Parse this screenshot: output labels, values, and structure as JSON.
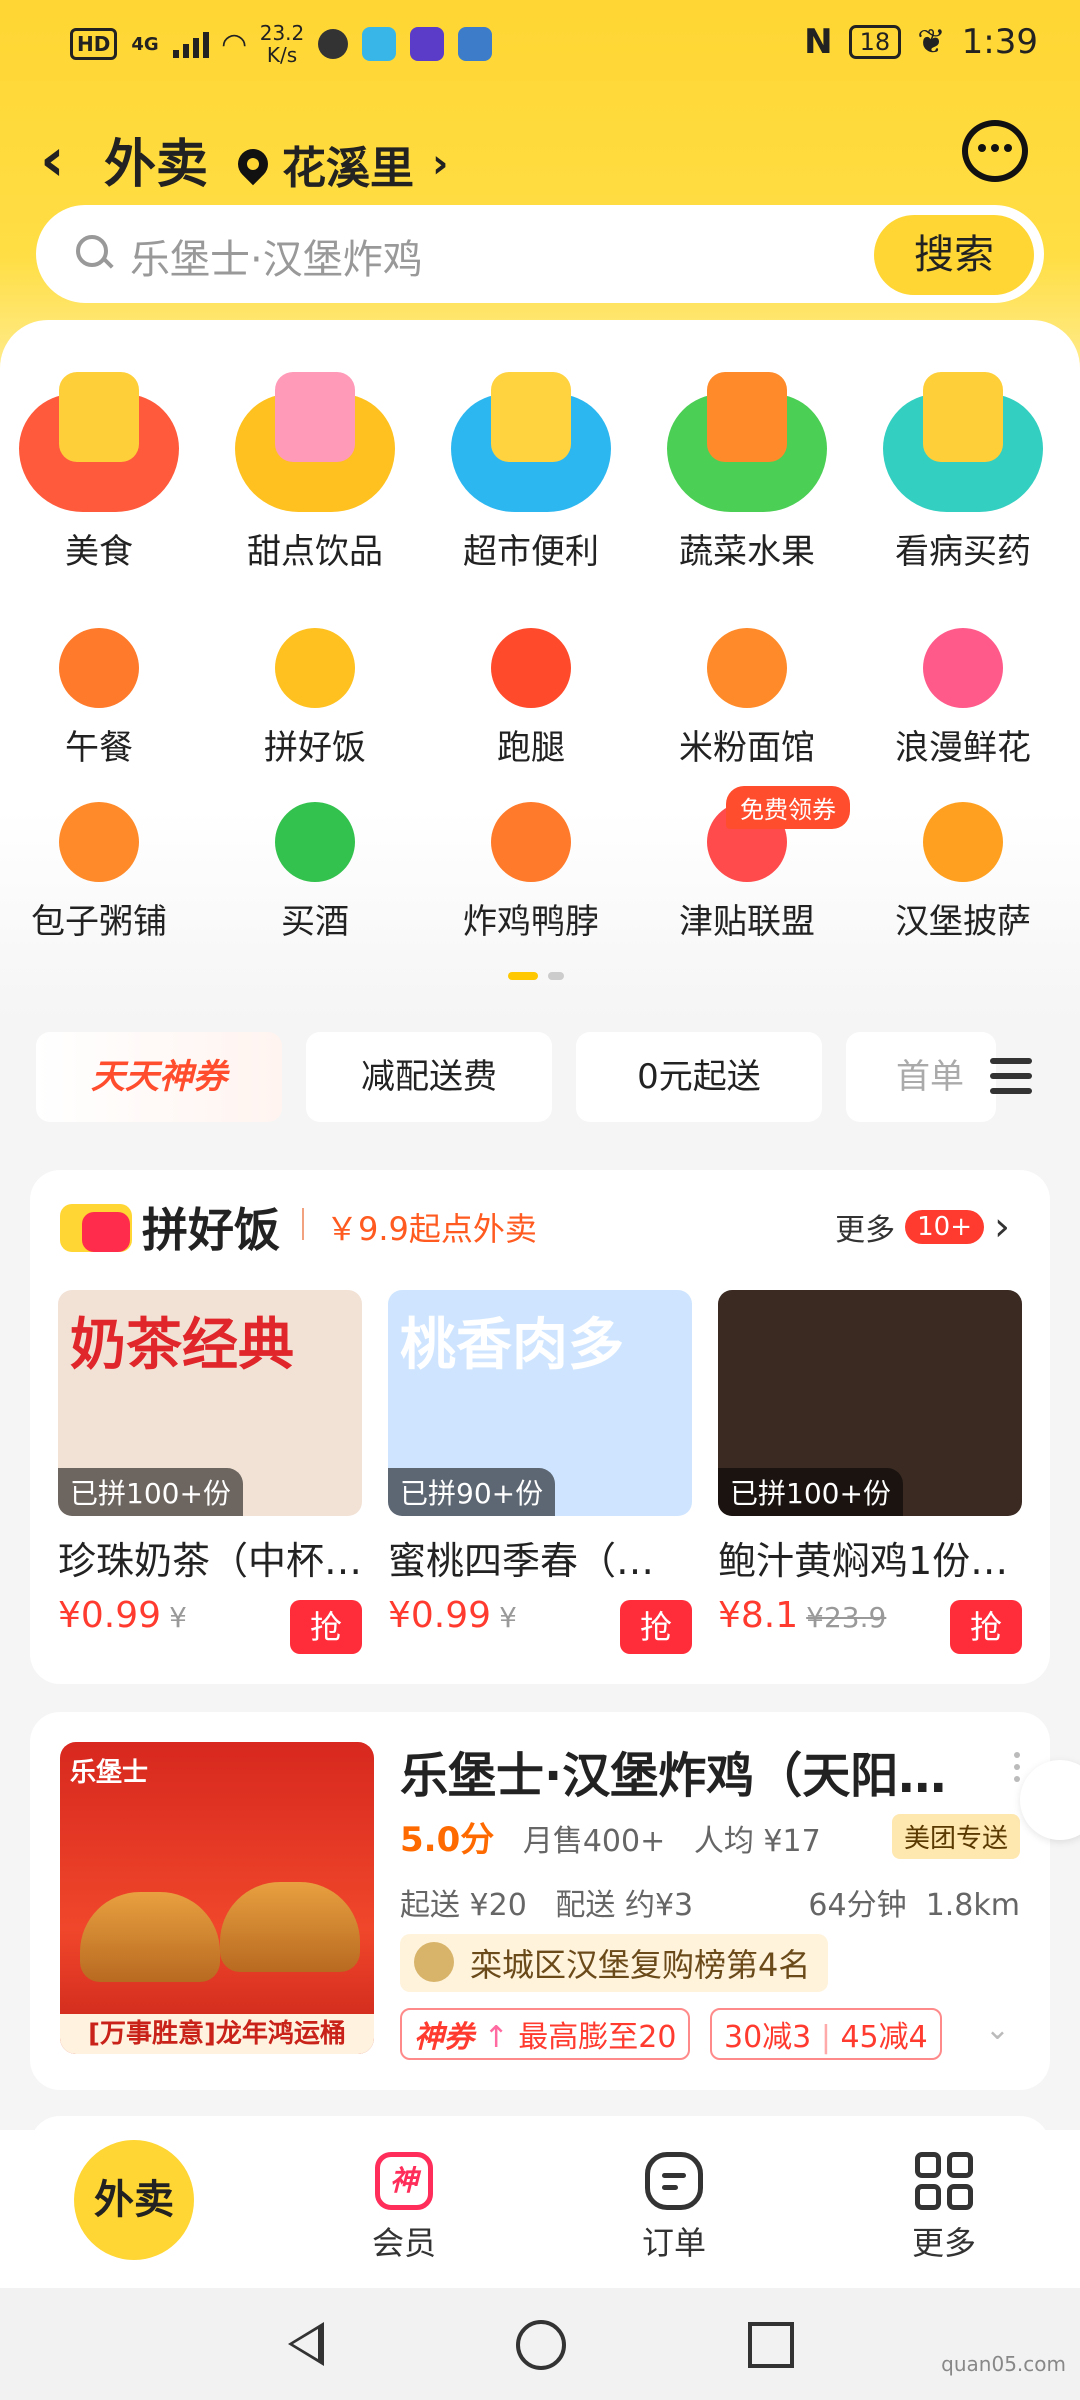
{
  "status_bar": {
    "hd": "HD",
    "net": "4G",
    "speed_val": "23.2",
    "speed_unit": "K/s",
    "battery": "18",
    "time": "1:39"
  },
  "header": {
    "title": "外卖",
    "location": "花溪里"
  },
  "search": {
    "placeholder": "乐堡士·汉堡炸鸡",
    "button": "搜索"
  },
  "categories_big": [
    {
      "label": "美食",
      "color": "#ff5a3c",
      "obj": "#ffcf3a"
    },
    {
      "label": "甜点饮品",
      "color": "#ffc11f",
      "obj": "#ff9ab8"
    },
    {
      "label": "超市便利",
      "color": "#2db7f0",
      "obj": "#ffd23f"
    },
    {
      "label": "蔬菜水果",
      "color": "#4ccf55",
      "obj": "#ff8a2a"
    },
    {
      "label": "看病买药",
      "color": "#33cfc0",
      "obj": "#ffcf3a"
    }
  ],
  "categories_small_row1": [
    {
      "label": "午餐",
      "color": "#ff7a2a"
    },
    {
      "label": "拼好饭",
      "color": "#ffc11f"
    },
    {
      "label": "跑腿",
      "color": "#ff4b2b"
    },
    {
      "label": "米粉面馆",
      "color": "#ff8a2a"
    },
    {
      "label": "浪漫鲜花",
      "color": "#ff5a8a"
    }
  ],
  "categories_small_row2": [
    {
      "label": "包子粥铺",
      "color": "#ff8a2a"
    },
    {
      "label": "买酒",
      "color": "#33c24d"
    },
    {
      "label": "炸鸡鸭脖",
      "color": "#ff7a2a"
    },
    {
      "label": "津贴联盟",
      "color": "#ff4b4b"
    },
    {
      "label": "汉堡披萨",
      "color": "#ffa020"
    }
  ],
  "subsidy_badge": "免费领券",
  "filters": {
    "f1": "天天神券",
    "f2": "减配送费",
    "f3": "0元起送",
    "f4": "首单"
  },
  "group_deal": {
    "title": "拼好饭",
    "subtitle": "￥9.9起点外卖",
    "more": "更多",
    "more_count": "10+",
    "items": [
      {
        "headline": "奶茶经典",
        "joined": "已拼100+份",
        "name": "珍珠奶茶（中杯…",
        "price": "¥0.99",
        "orig": "¥",
        "buy": "抢",
        "bg": "#f2e2d6",
        "hc": "#e0262a"
      },
      {
        "headline": "桃香肉多",
        "joined": "已拼90+份",
        "name": "蜜桃四季春（…",
        "price": "¥0.99",
        "orig": "¥",
        "buy": "抢",
        "bg": "#cfe5ff",
        "hc": "#ffffff"
      },
      {
        "headline": "",
        "joined": "已拼100+份",
        "name": "鲍汁黄焖鸡1份…",
        "price": "¥8.1",
        "orig": "¥23.9",
        "buy": "抢",
        "bg": "#3a2a22",
        "hc": "#ffffff"
      }
    ]
  },
  "store": {
    "brand": "乐堡士",
    "banner": "[万事胜意]龙年鸿运桶",
    "name": "乐堡士·汉堡炸鸡（天阳…",
    "rating": "5.0分",
    "monthly": "月售400+",
    "avg": "人均 ¥17",
    "delivery_tag": "美团专送",
    "min_order": "起送 ¥20",
    "fee": "配送 约¥3",
    "eta": "64分钟",
    "distance": "1.8km",
    "rank": "栾城区汉堡复购榜第4名",
    "coupon_prefix": "神券",
    "coupon": "最高膨至20",
    "promo1": "30减3",
    "promo2": "45减4"
  },
  "bottom_nav": {
    "home": "外卖",
    "vip": "会员",
    "vip_glyph": "神",
    "orders": "订单",
    "more": "更多"
  },
  "watermark": "quan05.com"
}
